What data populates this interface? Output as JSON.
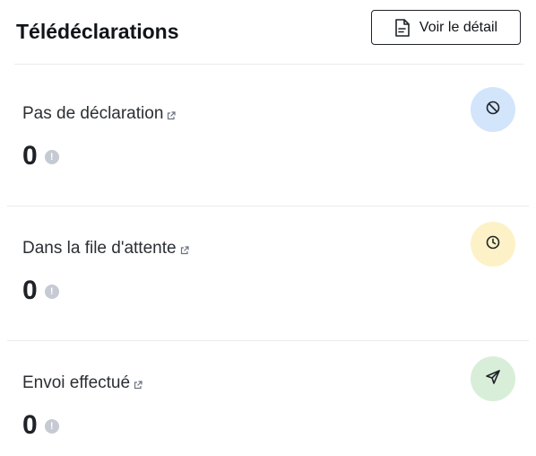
{
  "header": {
    "title": "Télédéclarations",
    "detail_button_label": "Voir le détail",
    "detail_icon": "file-text-icon"
  },
  "cards": [
    {
      "label": "Pas de déclaration",
      "value": "0",
      "info_glyph": "!",
      "icon": "ban-icon",
      "icon_bg": "#d3e5fb"
    },
    {
      "label": "Dans la file d'attente",
      "value": "0",
      "info_glyph": "!",
      "icon": "clock-icon",
      "icon_bg": "#fdf2c7"
    },
    {
      "label": "Envoi effectué",
      "value": "0",
      "info_glyph": "!",
      "icon": "send-icon",
      "icon_bg": "#d8eed8"
    }
  ]
}
